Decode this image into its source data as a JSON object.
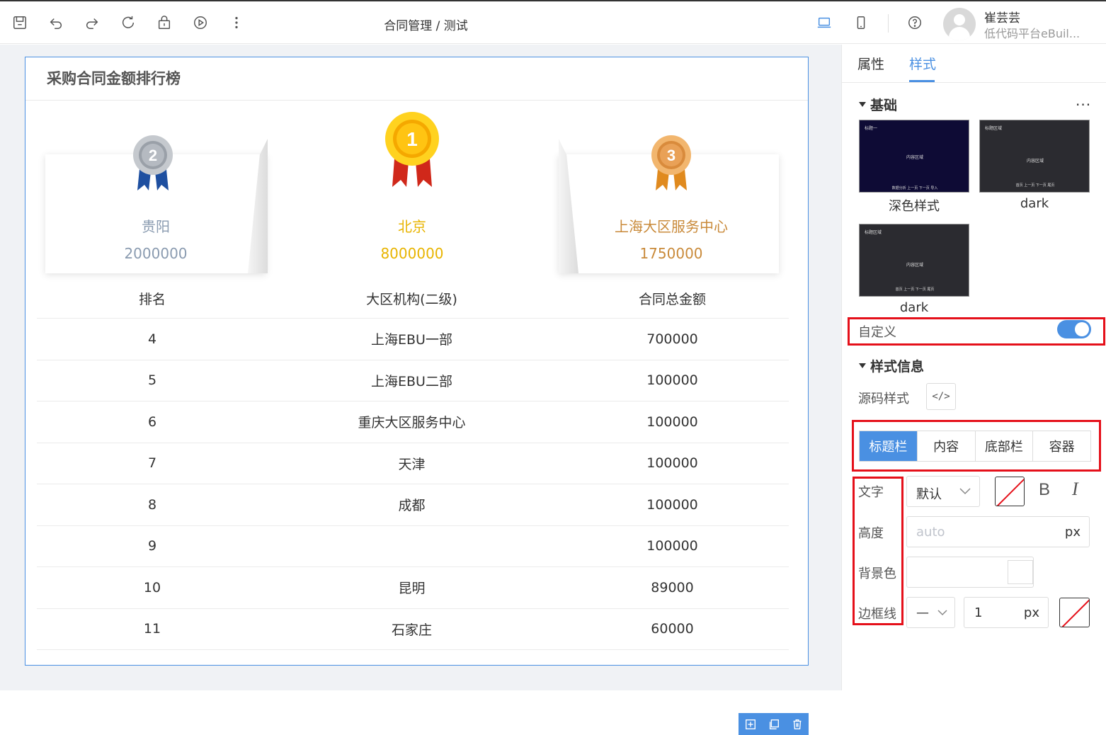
{
  "app": {
    "title": "合同管理 / 测试",
    "user": {
      "name": "崔芸芸",
      "org": "低代码平台eBuil..."
    }
  },
  "card": {
    "title": "采购合同金额排行榜",
    "podium": [
      {
        "rank": "2",
        "name": "贵阳",
        "value": "2000000",
        "color": "#8a9bb0"
      },
      {
        "rank": "1",
        "name": "北京",
        "value": "8000000",
        "color": "#e8b400"
      },
      {
        "rank": "3",
        "name": "上海大区服务中心",
        "value": "1750000",
        "color": "#c98a3a"
      }
    ],
    "table": {
      "headers": [
        "排名",
        "大区机构(二级)",
        "合同总金额"
      ],
      "rows": [
        [
          "4",
          "上海EBU一部",
          "700000"
        ],
        [
          "5",
          "上海EBU二部",
          "100000"
        ],
        [
          "6",
          "重庆大区服务中心",
          "100000"
        ],
        [
          "7",
          "天津",
          "100000"
        ],
        [
          "8",
          "成都",
          "100000"
        ],
        [
          "9",
          "",
          "100000"
        ],
        [
          "10",
          "昆明",
          "89000"
        ],
        [
          "11",
          "石家庄",
          "60000"
        ]
      ]
    }
  },
  "panel": {
    "tabs": [
      "属性",
      "样式"
    ],
    "active_tab": "样式",
    "basic": {
      "title": "基础",
      "more": "···",
      "themes": [
        {
          "label": "深色样式",
          "bg": "#0e0b35",
          "mini_title": "标题一",
          "mini_body": "内容区域",
          "mini_foot": "数据分析  上一页  下一页  导入"
        },
        {
          "label": "dark",
          "bg": "#2b2b30",
          "mini_title": "标题区域",
          "mini_body": "内容区域",
          "mini_foot": "首页  上一页  下一页  尾页"
        },
        {
          "label": "dark",
          "bg": "#2b2b30",
          "mini_title": "标题区域",
          "mini_body": "内容区域",
          "mini_foot": "首页  上一页  下一页  尾页"
        }
      ],
      "custom_label": "自定义",
      "custom_on": true
    },
    "style_info": {
      "title": "样式信息",
      "source_label": "源码样式",
      "source_icon": "</>",
      "segments": [
        "标题栏",
        "内容",
        "底部栏",
        "容器"
      ],
      "active_segment": "标题栏",
      "text_label": "文字",
      "font_select": "默认",
      "bold": "B",
      "italic": "I",
      "height_label": "高度",
      "height_placeholder": "auto",
      "height_unit": "px",
      "bg_label": "背景色",
      "border_label": "边框线",
      "border_style": "—",
      "border_width": "1",
      "border_unit": "px"
    }
  },
  "accent": "#4a90e2",
  "highlight": "#e5101a"
}
